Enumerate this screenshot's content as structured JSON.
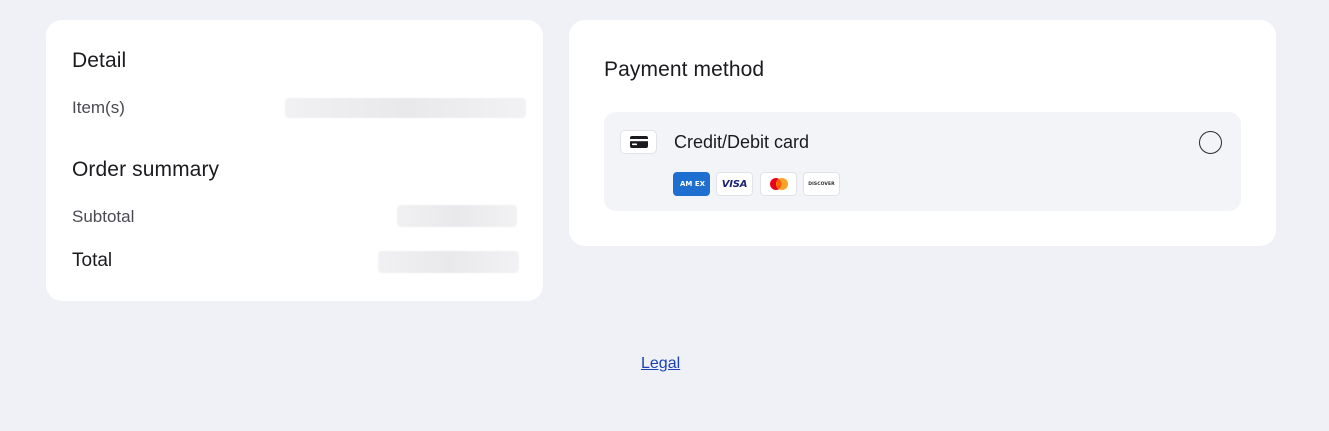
{
  "detail": {
    "title": "Detail",
    "items_label": "Item(s)"
  },
  "order_summary": {
    "title": "Order summary",
    "subtotal_label": "Subtotal",
    "total_label": "Total"
  },
  "payment": {
    "title": "Payment method",
    "methods": [
      {
        "label": "Credit/Debit card",
        "icon": "credit-card-icon",
        "selected": false,
        "brands": [
          {
            "name": "amex-icon",
            "text": "AM EX"
          },
          {
            "name": "visa-icon",
            "text": "VISA"
          },
          {
            "name": "mastercard-icon",
            "text": ""
          },
          {
            "name": "discover-icon",
            "text": "DISCOVER"
          }
        ]
      }
    ]
  },
  "footer": {
    "legal_label": "Legal"
  },
  "colors": {
    "background": "#f0f1f6",
    "card": "#ffffff",
    "method_box": "#f3f4f8",
    "link": "#1a3fb6",
    "amex": "#1f6fd0",
    "visa": "#1a1f71",
    "mastercard_red": "#eb001b",
    "mastercard_yellow": "#f79e1b"
  }
}
